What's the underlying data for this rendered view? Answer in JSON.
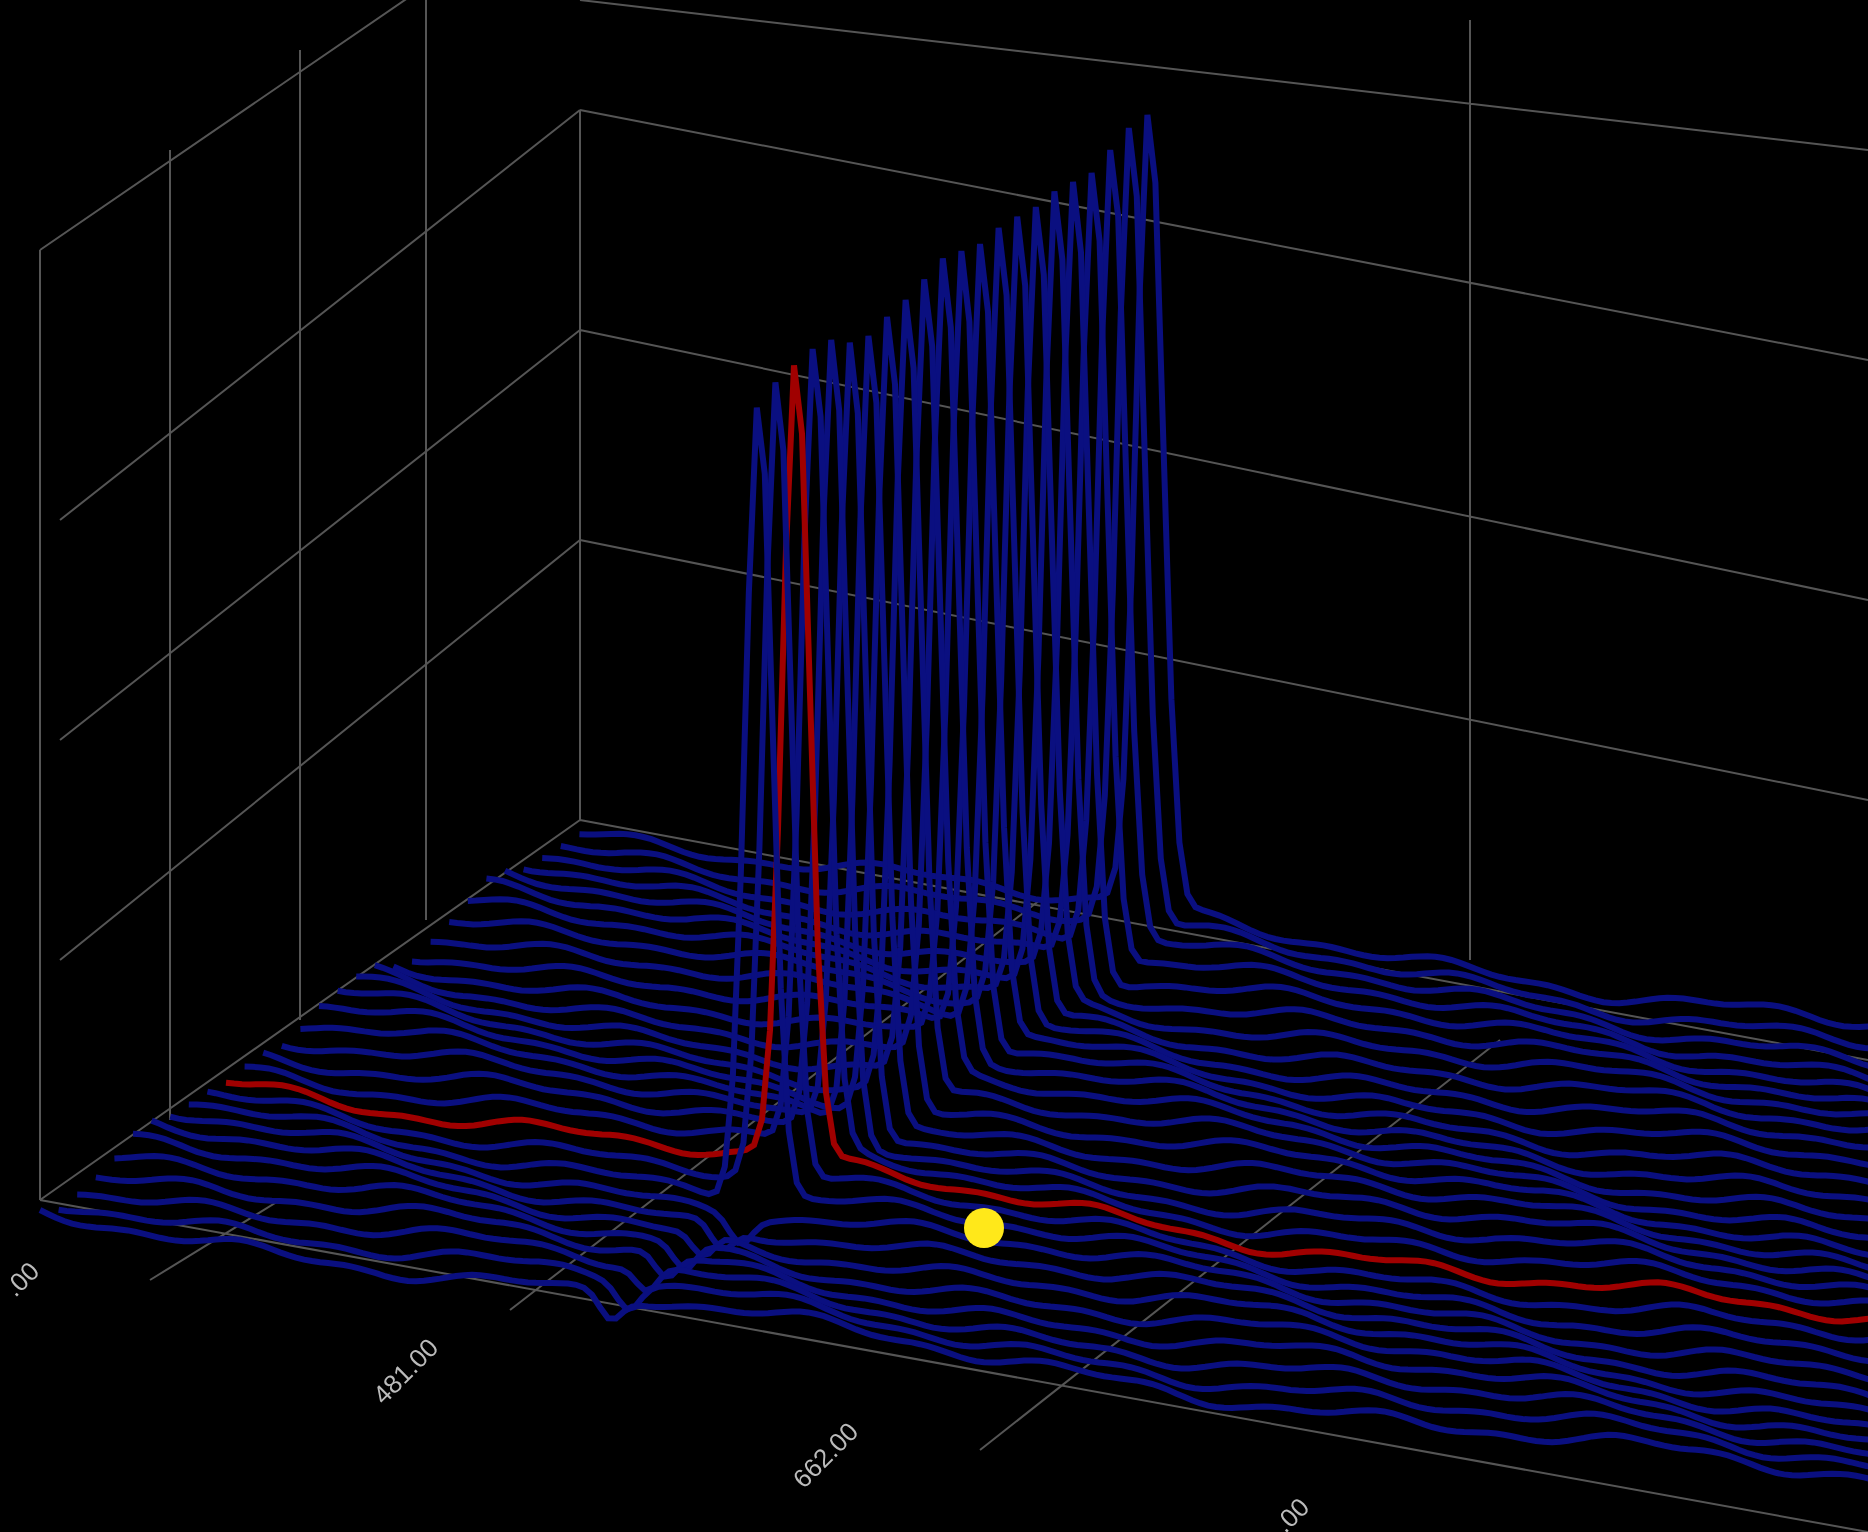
{
  "plot": {
    "x_tick_labels": [
      ".00",
      "481.00",
      "662.00",
      ".00"
    ]
  }
}
